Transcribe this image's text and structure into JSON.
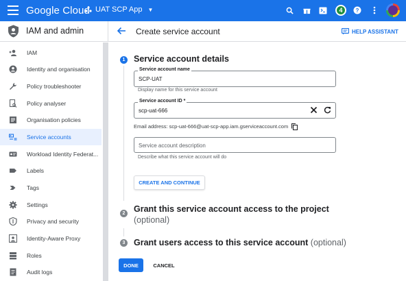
{
  "topbar": {
    "logo": "Google Cloud",
    "project": "UAT SCP App",
    "notification_count": "4",
    "accent": "#1a73e8"
  },
  "section": {
    "title": "IAM and admin",
    "icon": "shield-icon"
  },
  "page": {
    "title": "Create service account",
    "help": "HELP ASSISTANT"
  },
  "sidebar": {
    "items": [
      {
        "label": "IAM",
        "icon": "add-person-icon"
      },
      {
        "label": "Identity and organisation",
        "icon": "account-circle-icon"
      },
      {
        "label": "Policy troubleshooter",
        "icon": "wrench-icon"
      },
      {
        "label": "Policy analyser",
        "icon": "document-search-icon"
      },
      {
        "label": "Organisation policies",
        "icon": "list-box-icon"
      },
      {
        "label": "Service accounts",
        "icon": "service-account-icon",
        "active": true
      },
      {
        "label": "Workload Identity Federat...",
        "icon": "badge-icon"
      },
      {
        "label": "Labels",
        "icon": "label-icon"
      },
      {
        "label": "Tags",
        "icon": "tag-icon"
      },
      {
        "label": "Settings",
        "icon": "gear-icon"
      },
      {
        "label": "Privacy and security",
        "icon": "privacy-shield-icon"
      },
      {
        "label": "Identity-Aware Proxy",
        "icon": "proxy-icon"
      },
      {
        "label": "Roles",
        "icon": "roles-icon"
      },
      {
        "label": "Audit logs",
        "icon": "audit-log-icon"
      }
    ]
  },
  "step1": {
    "number": "1",
    "title": "Service account details",
    "name_label": "Service account name",
    "name_value": "SCP-UAT",
    "name_hint": "Display name for this service account",
    "id_label": "Service account ID *",
    "id_value": "scp-uat-666",
    "email": "Email address: scp-uat-666@uat-scp-app.iam.gserviceaccount.com",
    "description_placeholder": "Service account description",
    "description_hint": "Describe what this service account will do",
    "create_button": "CREATE AND CONTINUE"
  },
  "step2": {
    "number": "2",
    "title": "Grant this service account access to the project",
    "optional": "(optional)"
  },
  "step3": {
    "number": "3",
    "title": "Grant users access to this service account",
    "optional": "(optional)"
  },
  "actions": {
    "done": "DONE",
    "cancel": "CANCEL"
  }
}
